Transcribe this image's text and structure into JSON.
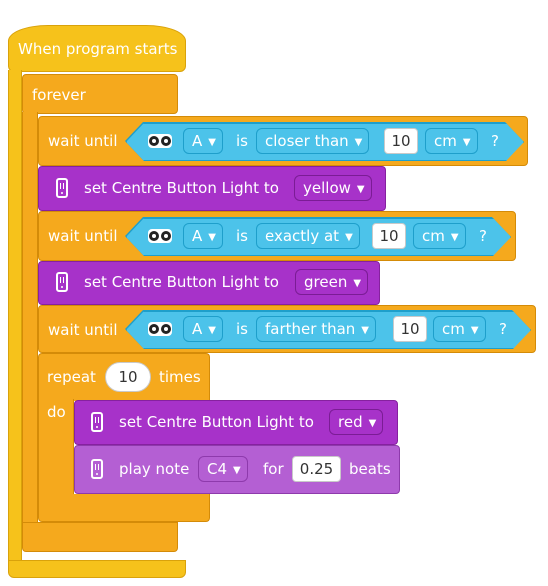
{
  "program": {
    "hat_label": "When program starts",
    "forever_label": "forever"
  },
  "wait1": {
    "label": "wait until",
    "port": "A",
    "is": "is",
    "comparison": "closer than",
    "value": "10",
    "unit": "cm",
    "q": "?"
  },
  "light1": {
    "label": "set Centre Button Light to",
    "color": "yellow"
  },
  "wait2": {
    "label": "wait until",
    "port": "A",
    "is": "is",
    "comparison": "exactly at",
    "value": "10",
    "unit": "cm",
    "q": "?"
  },
  "light2": {
    "label": "set Centre Button Light to",
    "color": "green"
  },
  "wait3": {
    "label": "wait until",
    "port": "A",
    "is": "is",
    "comparison": "farther than",
    "value": "10",
    "unit": "cm",
    "q": "?"
  },
  "repeat": {
    "label": "repeat",
    "count": "10",
    "times": "times",
    "do": "do"
  },
  "light3": {
    "label": "set Centre Button Light to",
    "color": "red"
  },
  "note": {
    "label": "play note",
    "pitch": "C4",
    "for": "for",
    "beats_value": "0.25",
    "beats": "beats"
  },
  "colors": {
    "event": "#f6c21b",
    "control": "#f5a91d",
    "sensor": "#4cc3ea",
    "light": "#a732c9",
    "sound": "#b45fd3"
  },
  "icons": [
    "ultrasonic-sensor-icon",
    "hub-icon",
    "dropdown-caret-icon"
  ]
}
